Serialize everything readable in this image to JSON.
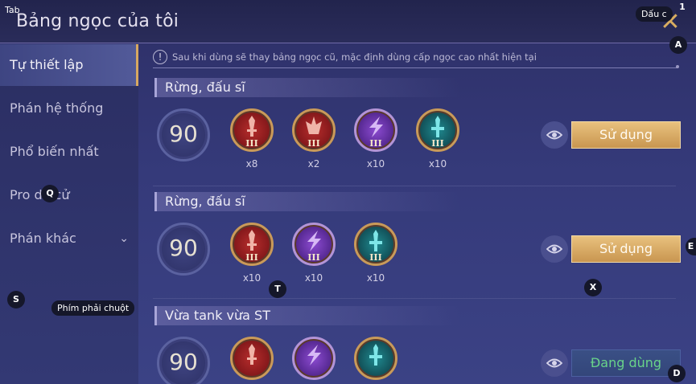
{
  "header": {
    "title": "Bảng ngọc của tôi",
    "close_label": "✕"
  },
  "sidebar": {
    "items": [
      {
        "label": "Tự thiết lập",
        "active": true
      },
      {
        "label": "Phán hệ thống"
      },
      {
        "label": "Phổ biến nhất"
      },
      {
        "label": "Pro dé cử"
      },
      {
        "label": "Phán khác",
        "has_chevron": true
      }
    ]
  },
  "notice": {
    "text": "Sau khi dùng sẽ thay bảng ngọc cũ, mặc định dùng cấp ngọc cao nhất hiện tại"
  },
  "sections": [
    {
      "title": "Rừng, đấu sĩ",
      "level": "90",
      "gems": [
        {
          "color": "red",
          "icon": "sword-gem-icon",
          "tier": "III",
          "count": "x8"
        },
        {
          "color": "red",
          "icon": "crown-gem-icon",
          "tier": "III",
          "count": "x2"
        },
        {
          "color": "purple",
          "icon": "lightning-gem-icon",
          "tier": "III",
          "count": "x10"
        },
        {
          "color": "teal",
          "icon": "sword-gem-icon",
          "tier": "III",
          "count": "x10"
        }
      ],
      "button": "Sử dụng",
      "in_use": false
    },
    {
      "title": "Rừng, đấu sĩ",
      "level": "90",
      "gems": [
        {
          "color": "red",
          "icon": "sword-gem-icon",
          "tier": "III",
          "count": "x10"
        },
        {
          "color": "purple",
          "icon": "lightning-gem-icon",
          "tier": "III",
          "count": "x10"
        },
        {
          "color": "teal",
          "icon": "sword-gem-icon",
          "tier": "III",
          "count": "x10"
        }
      ],
      "button": "Sử dụng",
      "in_use": false
    },
    {
      "title": "Vừa tank vừa ST",
      "level": "90",
      "gems": [
        {
          "color": "red",
          "icon": "sword-gem-icon",
          "tier": "",
          "count": ""
        },
        {
          "color": "purple",
          "icon": "lightning-gem-icon",
          "tier": "",
          "count": ""
        },
        {
          "color": "teal",
          "icon": "sword-gem-icon",
          "tier": "",
          "count": ""
        }
      ],
      "button": "Đang dùng",
      "in_use": true
    }
  ],
  "overlay": {
    "tab_label": "Tab",
    "top_right_label": "Dấu c",
    "key_1": "1",
    "key_a": "A",
    "key_q": "Q",
    "key_s": "S",
    "key_t": "T",
    "key_x": "X",
    "key_d": "D",
    "key_e": "E",
    "right_click_label": "Phím phải chuột"
  },
  "colors": {
    "accent_gold": "#d7a861",
    "in_use_green": "#69d38a"
  }
}
